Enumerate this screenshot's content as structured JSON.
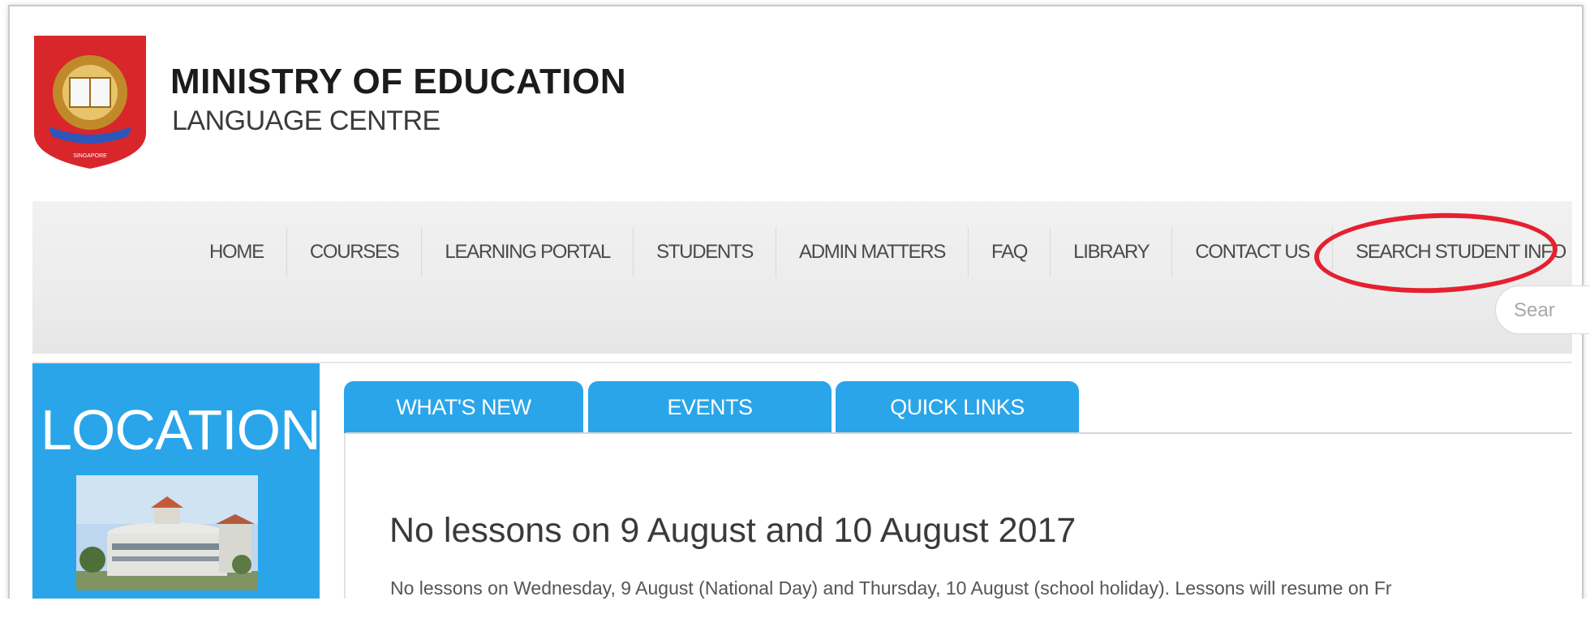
{
  "header": {
    "title": "MINISTRY OF EDUCATION",
    "subtitle": "LANGUAGE CENTRE",
    "logo_text": "SINGAPORE"
  },
  "nav": {
    "items": [
      "HOME",
      "COURSES",
      "LEARNING PORTAL",
      "STUDENTS",
      "ADMIN MATTERS",
      "FAQ",
      "LIBRARY",
      "CONTACT US",
      "SEARCH STUDENT INFO"
    ],
    "search_text": "Sear"
  },
  "sidebar": {
    "title": "LOCATION"
  },
  "tabs": [
    "WHAT'S NEW",
    "EVENTS",
    "QUICK LINKS"
  ],
  "news": {
    "heading": "No lessons on 9 August and 10 August 2017",
    "body": "No lessons on Wednesday, 9 August (National Day) and Thursday, 10 August (school holiday). Lessons will resume on Fr"
  },
  "colors": {
    "accent": "#2aa5ea",
    "highlight": "#e42130",
    "logo_red": "#d8262b"
  }
}
